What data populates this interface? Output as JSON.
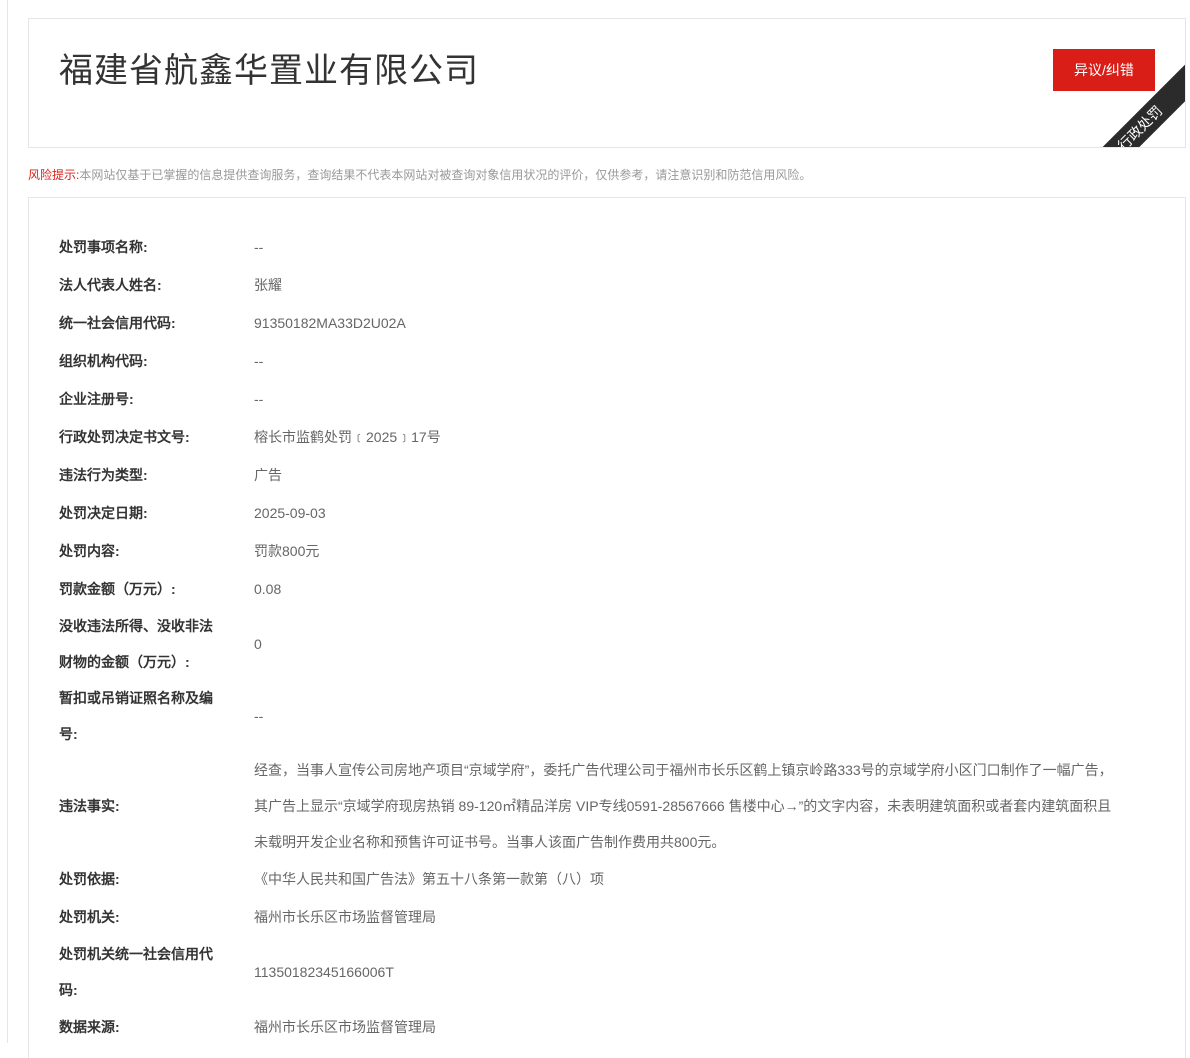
{
  "header": {
    "company_name": "福建省航鑫华置业有限公司",
    "dispute_button_label": "异议/纠错",
    "ribbon_label": "行政处罚",
    "accent_color": "#d91e18"
  },
  "risk_notice": {
    "label": "风险提示:",
    "text": "本网站仅基于已掌握的信息提供查询服务，查询结果不代表本网站对被查询对象信用状况的评价，仅供参考，请注意识别和防范信用风险。"
  },
  "details": [
    {
      "label": "处罚事项名称:",
      "value": "--"
    },
    {
      "label": "法人代表人姓名:",
      "value": "张耀"
    },
    {
      "label": "统一社会信用代码:",
      "value": "91350182MA33D2U02A"
    },
    {
      "label": "组织机构代码:",
      "value": "--"
    },
    {
      "label": "企业注册号:",
      "value": "--"
    },
    {
      "label": "行政处罚决定书文号:",
      "value": "榕长市监鹤处罚﹝2025﹞17号"
    },
    {
      "label": "违法行为类型:",
      "value": "广告"
    },
    {
      "label": "处罚决定日期:",
      "value": "2025-09-03"
    },
    {
      "label": "处罚内容:",
      "value": "罚款800元"
    },
    {
      "label": "罚款金额（万元）:",
      "value": "0.08"
    },
    {
      "label": "没收违法所得、没收非法财物的金额（万元）:",
      "value": "0"
    },
    {
      "label": "暂扣或吊销证照名称及编号:",
      "value": "--"
    },
    {
      "label": "违法事实:",
      "value": "经查，当事人宣传公司房地产项目“京域学府”，委托广告代理公司于福州市长乐区鹤上镇京岭路333号的京域学府小区门口制作了一幅广告，其广告上显示“京域学府现房热销 89-120㎡精品洋房 VIP专线0591-28567666 售楼中心→”的文字内容，未表明建筑面积或者套内建筑面积且未载明开发企业名称和预售许可证书号。当事人该面广告制作费用共800元。"
    },
    {
      "label": "处罚依据:",
      "value": "《中华人民共和国广告法》第五十八条第一款第（八）项"
    },
    {
      "label": "处罚机关:",
      "value": "福州市长乐区市场监督管理局"
    },
    {
      "label": "处罚机关统一社会信用代码:",
      "value": "11350182345166006T"
    },
    {
      "label": "数据来源:",
      "value": "福州市长乐区市场监督管理局"
    }
  ]
}
